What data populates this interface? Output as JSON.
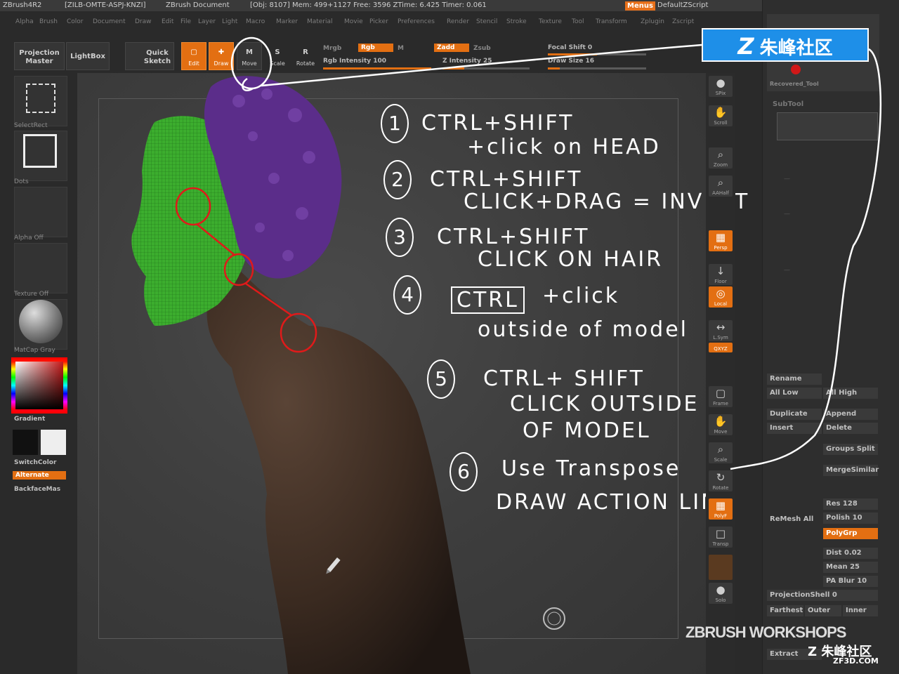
{
  "titlebar": {
    "app": "ZBrush4R2",
    "build": "[ZILB-OMTE-ASPJ-KNZI]",
    "doc": "ZBrush Document",
    "obj": "[Obj: 8107] Mem: 499+1127 Free: 3596 ZTime: 6.425 Timer: 0.061",
    "menus": "Menus",
    "zscript": "DefaultZScript"
  },
  "menubar": [
    "Alpha",
    "Brush",
    "Color",
    "Document",
    "Draw",
    "Edit",
    "File",
    "Layer",
    "Light",
    "Macro",
    "Marker",
    "Material",
    "Movie",
    "Picker",
    "Preferences",
    "Render",
    "Stencil",
    "Stroke",
    "Texture",
    "Tool",
    "Transform",
    "Zplugin",
    "Zscript"
  ],
  "toolbar": {
    "projection_master": "Projection Master",
    "lightbox": "LightBox",
    "quick_sketch": "Quick Sketch",
    "edit": "Edit",
    "draw": "Draw",
    "move": "Move",
    "scale": "Scale",
    "rotate": "Rotate",
    "mrgb": "Mrgb",
    "rgb": "Rgb",
    "m": "M",
    "rgb_intensity": "Rgb Intensity 100",
    "zadd": "Zadd",
    "zsub": "Zsub",
    "z_intensity": "Z Intensity 25",
    "focal_shift": "Focal Shift 0",
    "draw_size": "Draw Size 16"
  },
  "left_shelf": {
    "tile_labels": [
      "SelectRect",
      "Dots",
      "Alpha Off",
      "Texture Off",
      "MatCap Gray"
    ],
    "gradient": "Gradient",
    "switchcolor": "SwitchColor",
    "alternate": "Alternate",
    "backfacemask": "BackfaceMas"
  },
  "right_shelf": [
    {
      "icon": "●",
      "label": "SPix"
    },
    {
      "icon": "✋",
      "label": "Scroll"
    },
    {
      "icon": "⌕",
      "label": "Zoom"
    },
    {
      "icon": "⌕",
      "label": "AAHalf"
    },
    {
      "icon": "▦",
      "label": "Persp"
    },
    {
      "icon": "↓",
      "label": "Floor"
    },
    {
      "icon": "◎",
      "label": "Local"
    },
    {
      "icon": "↔",
      "label": "L.Sym"
    },
    {
      "icon": "",
      "label": "QXYZ"
    },
    {
      "icon": "▢",
      "label": "Frame"
    },
    {
      "icon": "✋",
      "label": "Move"
    },
    {
      "icon": "⌕",
      "label": "Scale"
    },
    {
      "icon": "↻",
      "label": "Rotate"
    },
    {
      "icon": "▦",
      "label": "PolyF"
    },
    {
      "icon": "□",
      "label": "Transp"
    },
    {
      "icon": "",
      "label": ""
    },
    {
      "icon": "●",
      "label": "Solo"
    }
  ],
  "tray": {
    "recovered": "Recovered_Tool",
    "subtool": "SubTool",
    "rename": "Rename",
    "all_low": "All Low",
    "all_high": "All High",
    "duplicate": "Duplicate",
    "append": "Append",
    "insert": "Insert",
    "delete": "Delete",
    "groups_split": "Groups Split",
    "merge_similar": "MergeSimilar",
    "res": "Res 128",
    "polish": "Polish 10",
    "remesh_all": "ReMesh All",
    "polygrp": "PolyGrp",
    "dist": "Dist 0.02",
    "mean": "Mean 25",
    "pa_blur": "PA Blur 10",
    "projection_shell": "ProjectionShell 0",
    "farthest": "Farthest",
    "outer": "Outer",
    "inner": "Inner",
    "extract": "Extract"
  },
  "annotations": {
    "step1_a": "CTRL+SHIFT",
    "step1_b": "+click on HEAD",
    "step2_a": "CTRL+SHIFT",
    "step2_b": "CLICK+DRAG = INVERT",
    "step3_a": "CTRL+SHIFT",
    "step3_b": "CLICK ON HAIR",
    "step4_a": "CTRL",
    "step4_b": "+click",
    "step4_c": "outside of model",
    "step5_a": "CTRL+ SHIFT",
    "step5_b": "CLICK OUTSIDE",
    "step5_c": "OF MODEL",
    "step6_a": "Use Transpose",
    "step6_b": "DRAW ACTION LINE",
    "n1": "1",
    "n2": "2",
    "n3": "3",
    "n4": "4",
    "n5": "5",
    "n6": "6"
  },
  "logo": {
    "text": "朱峰社区"
  },
  "watermark": {
    "main": "ZBRUSH WORKSHOPS",
    "cn": "朱峰社区",
    "url": "ZF3D.COM"
  },
  "colors": {
    "accent": "#e36f12",
    "head": "#3cad2e",
    "hair": "#5b2d8a",
    "body": "#3b2a20",
    "annotation_red": "#e01a1a"
  }
}
